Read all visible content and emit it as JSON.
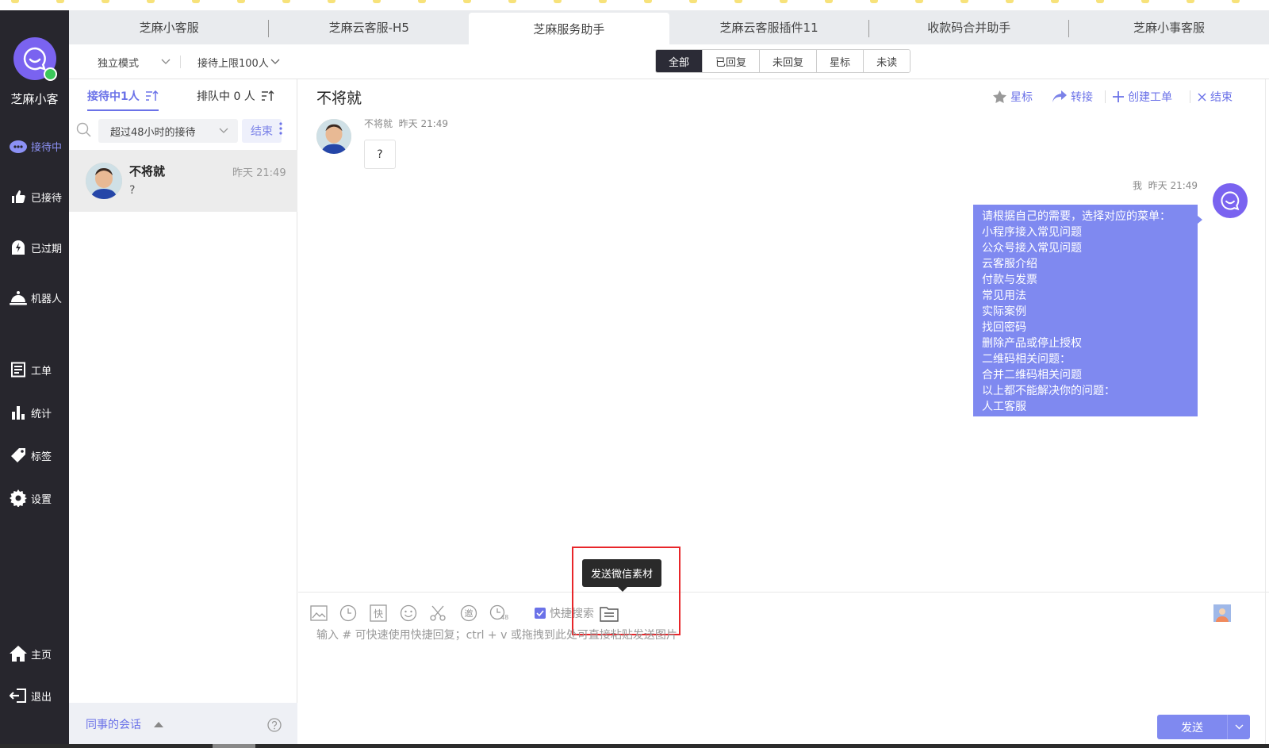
{
  "sidebar": {
    "app_name": "芝麻小客",
    "items": [
      {
        "label": "接待中",
        "icon": "robot-chat-icon"
      },
      {
        "label": "已接待",
        "icon": "thumbs-up-icon"
      },
      {
        "label": "已过期",
        "icon": "expired-icon"
      },
      {
        "label": "机器人",
        "icon": "service-bell-icon"
      },
      {
        "label": "工单",
        "icon": "ticket-icon"
      },
      {
        "label": "统计",
        "icon": "bar-chart-icon"
      },
      {
        "label": "标签",
        "icon": "tag-icon"
      },
      {
        "label": "设置",
        "icon": "gear-icon"
      },
      {
        "label": "主页",
        "icon": "home-icon"
      },
      {
        "label": "退出",
        "icon": "logout-icon"
      }
    ]
  },
  "tabs": [
    {
      "label": "芝麻小客服"
    },
    {
      "label": "芝麻云客服-H5"
    },
    {
      "label": "芝麻服务助手"
    },
    {
      "label": "芝麻云客服插件11"
    },
    {
      "label": "收款码合并助手"
    },
    {
      "label": "芝麻小事客服"
    }
  ],
  "toolbar": {
    "mode": "独立模式",
    "limit": "接待上限100人",
    "filters": [
      "全部",
      "已回复",
      "未回复",
      "星标",
      "未读"
    ]
  },
  "list": {
    "tab_serving": "接待中1人",
    "tab_queue": "排队中 0 人",
    "search_filter": "超过48小时的接待",
    "end_label": "结束",
    "conversation": {
      "name": "不将就",
      "time": "昨天 21:49",
      "preview": "?"
    },
    "footer_label": "同事的会话"
  },
  "chat": {
    "title": "不将就",
    "actions": {
      "star": "星标",
      "transfer": "转接",
      "create_ticket": "创建工单",
      "end": "结束"
    },
    "incoming": {
      "sender": "不将就",
      "time": "昨天 21:49",
      "text": "?"
    },
    "outgoing": {
      "sender": "我",
      "time": "昨天 21:49",
      "lines": [
        "请根据自己的需要，选择对应的菜单：",
        "小程序接入常见问题",
        "公众号接入常见问题",
        "云客服介绍",
        "付款与发票",
        "常见用法",
        "实际案例",
        "找回密码",
        "删除产品或停止授权",
        "二维码相关问题：",
        "合并二维码相关问题",
        "以上都不能解决你的问题：",
        "人工客服"
      ]
    }
  },
  "composer": {
    "quick_search": "快捷搜索",
    "tooltip": "发送微信素材",
    "placeholder": "输入 # 可快速使用快捷回复；ctrl + v 或拖拽到此处可直接粘贴发送图片",
    "quick_reply_glyph": "快",
    "invite_glyph": "邀",
    "timer_badge": "48",
    "send_label": "发送"
  },
  "colors": {
    "accent": "#6b72e8",
    "bubble": "#7f89f0",
    "sidebar": "#27262d",
    "highlight": "#e8262a"
  }
}
